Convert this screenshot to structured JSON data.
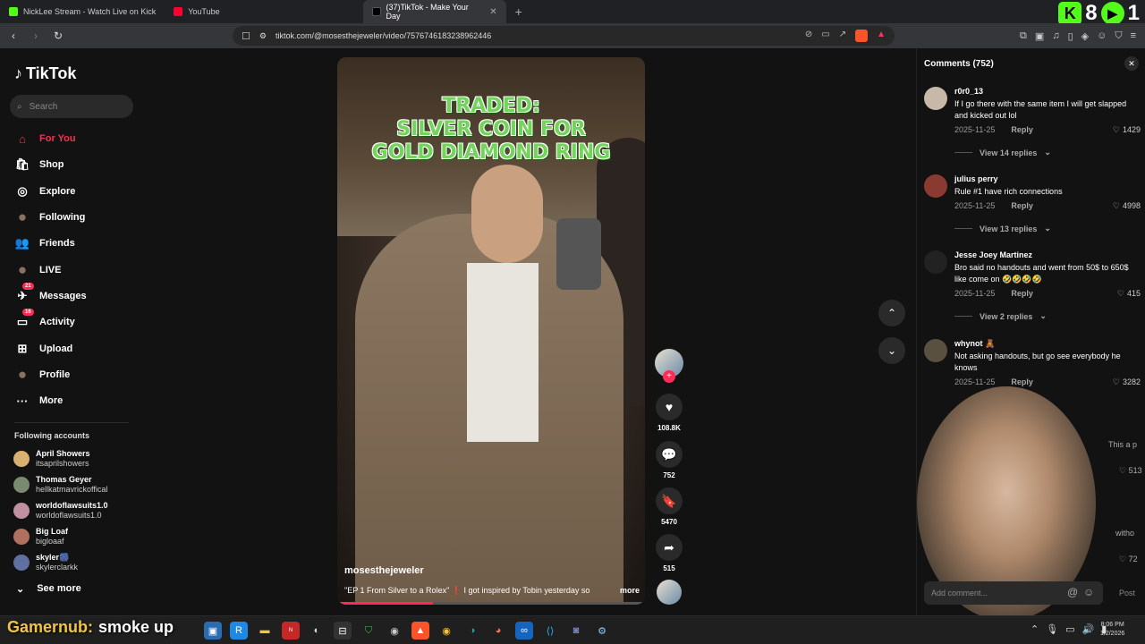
{
  "browser": {
    "tabs": [
      {
        "label": "NickLee Stream - Watch Live on Kick"
      },
      {
        "label": "YouTube"
      },
      {
        "label": "(37)TikTok - Make Your Day"
      }
    ],
    "url": "tiktok.com/@mosesthejeweler/video/7576746183238962446",
    "kick_count": "8",
    "kick_suffix": "1"
  },
  "sidebar": {
    "logo": "TikTok",
    "search_placeholder": "Search",
    "nav": [
      {
        "label": "For You",
        "icon": "home-icon",
        "glyph": "⌂"
      },
      {
        "label": "Shop",
        "icon": "shop-icon",
        "glyph": "🛍"
      },
      {
        "label": "Explore",
        "icon": "compass-icon",
        "glyph": "◎"
      },
      {
        "label": "Following",
        "icon": "following-avatar-icon",
        "glyph": "●"
      },
      {
        "label": "Friends",
        "icon": "friends-icon",
        "glyph": "👥"
      },
      {
        "label": "LIVE",
        "icon": "live-avatar-icon",
        "glyph": "●"
      },
      {
        "label": "Messages",
        "icon": "messages-icon",
        "glyph": "✈",
        "badge": "21"
      },
      {
        "label": "Activity",
        "icon": "activity-icon",
        "glyph": "▭",
        "badge": "16"
      },
      {
        "label": "Upload",
        "icon": "upload-icon",
        "glyph": "⊞"
      },
      {
        "label": "Profile",
        "icon": "profile-avatar-icon",
        "glyph": "●"
      },
      {
        "label": "More",
        "icon": "more-icon",
        "glyph": "···"
      }
    ],
    "following_header": "Following accounts",
    "following": [
      {
        "name": "April Showers",
        "handle": "itsaprilshowers",
        "color": "#d8b070"
      },
      {
        "name": "Thomas Geyer",
        "handle": "hellkatmavrickoffical",
        "color": "#7a8a70"
      },
      {
        "name": "worldoflawsuits1.0",
        "handle": "worldoflawsuits1.0",
        "color": "#c090a0"
      },
      {
        "name": "Big Loaf",
        "handle": "bigloaaf",
        "color": "#b07060"
      },
      {
        "name": "skyler🎆",
        "handle": "skylerclarkk",
        "color": "#6070a0"
      }
    ],
    "see_more": "See more"
  },
  "video": {
    "headline": [
      "TRADED:",
      "SILVER COIN FOR",
      "GOLD DIAMOND RING"
    ],
    "author": "mosesthejeweler",
    "caption": "\"EP 1 From Silver to a Rolex\" ❗ I got inspired by Tobin yesterday so",
    "more": "more",
    "progress_fraction": 0.31,
    "likes": "108.8K",
    "comments": "752",
    "saves": "5470",
    "shares": "515"
  },
  "comments_panel": {
    "title": "Comments (752)",
    "comments": [
      {
        "user": "r0r0_13",
        "text": "If I go there with the same item I will get slapped and kicked out lol",
        "date": "2025-11-25",
        "reply": "Reply",
        "likes": "1429",
        "view_replies": "View 14 replies",
        "color": "#c8b8a8"
      },
      {
        "user": "julius perry",
        "text": "Rule #1 have rich connections",
        "date": "2025-11-25",
        "reply": "Reply",
        "likes": "4998",
        "view_replies": "View 13 replies",
        "color": "#8a3a30"
      },
      {
        "user": "Jesse Joey Martinez",
        "text": "Bro said no handouts and went from 50$ to 650$ like come on 🤣🤣🤣🤣",
        "date": "2025-11-25",
        "reply": "Reply",
        "likes": "415",
        "view_replies": "View 2 replies",
        "color": "#222222"
      },
      {
        "user": "whynot 🧸",
        "text": "Not asking handouts, but go see everybody he knows",
        "date": "2025-11-25",
        "reply": "Reply",
        "likes": "3282",
        "view_replies": "",
        "color": "#5a5040"
      }
    ],
    "peek_1": "This a p",
    "peek_1_likes": "513",
    "peek_2": "witho",
    "peek_2_likes": "72",
    "add_placeholder": "Add comment...",
    "post": "Post"
  },
  "taskbar": {
    "overlay_user": "Gamernub:",
    "overlay_msg": "smoke up",
    "time": "8:06 PM",
    "date": "1/2/2026"
  }
}
